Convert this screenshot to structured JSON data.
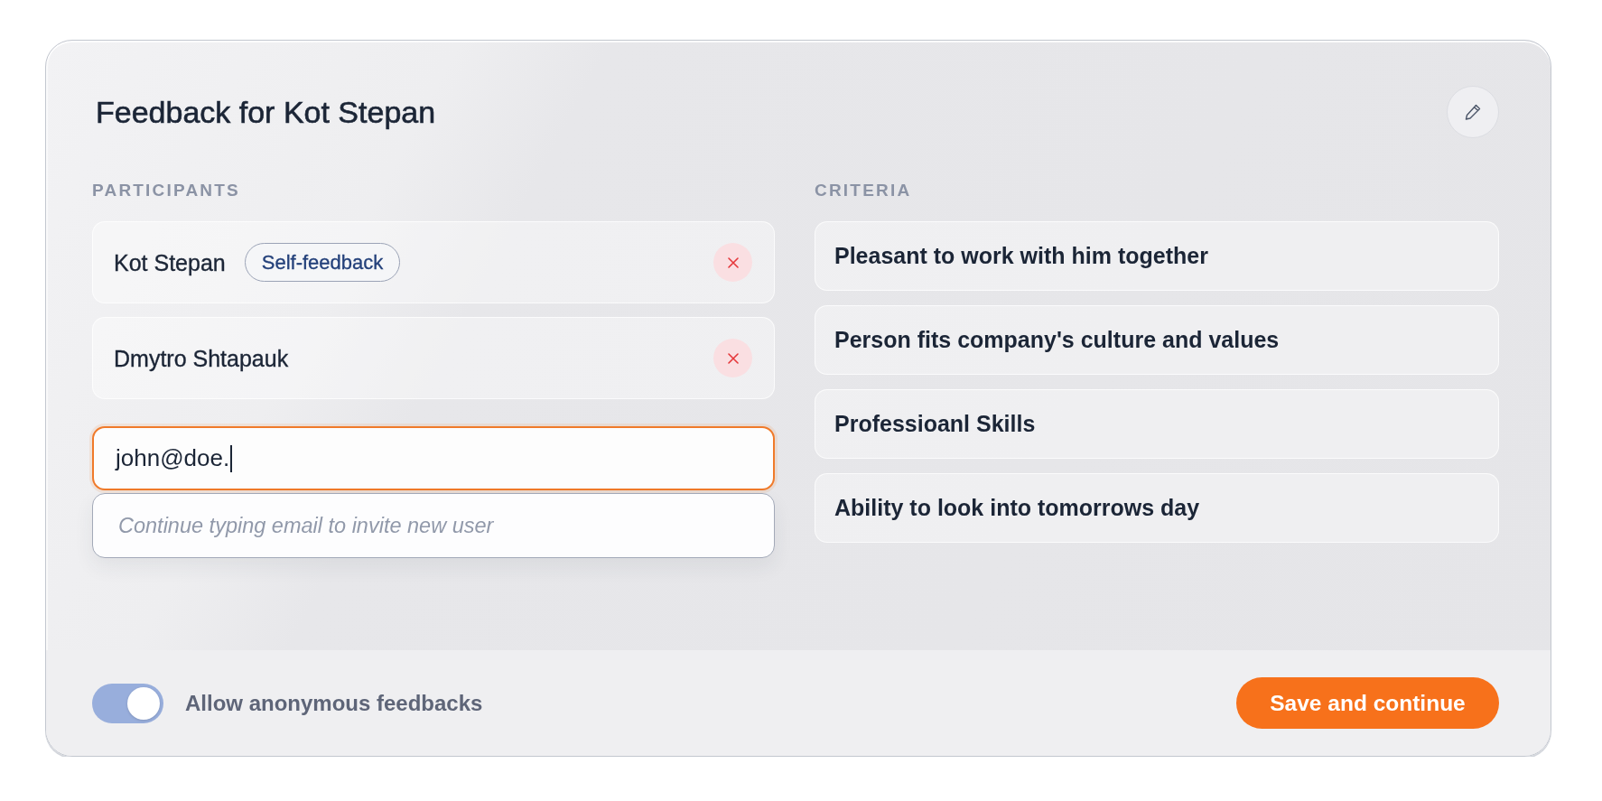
{
  "title": "Feedback for Kot Stepan",
  "participants": {
    "label": "PARTICIPANTS",
    "items": [
      {
        "name": "Kot Stepan",
        "tag": "Self-feedback"
      },
      {
        "name": "Dmytro Shtapauk"
      }
    ],
    "invite": {
      "value": "john@doe.",
      "focused": true,
      "suggestion": "Continue typing email to invite new user"
    }
  },
  "criteria": {
    "label": "CRITERIA",
    "items": [
      {
        "text": "Pleasant to work with him together"
      },
      {
        "text": "Person fits company's culture and values"
      },
      {
        "text": "Professioanl Skills"
      },
      {
        "text": "Ability to look into tomorrows day"
      }
    ]
  },
  "footer": {
    "anonymous": {
      "label": "Allow anonymous feedbacks",
      "on": true
    },
    "save_button": "Save and continue"
  }
}
